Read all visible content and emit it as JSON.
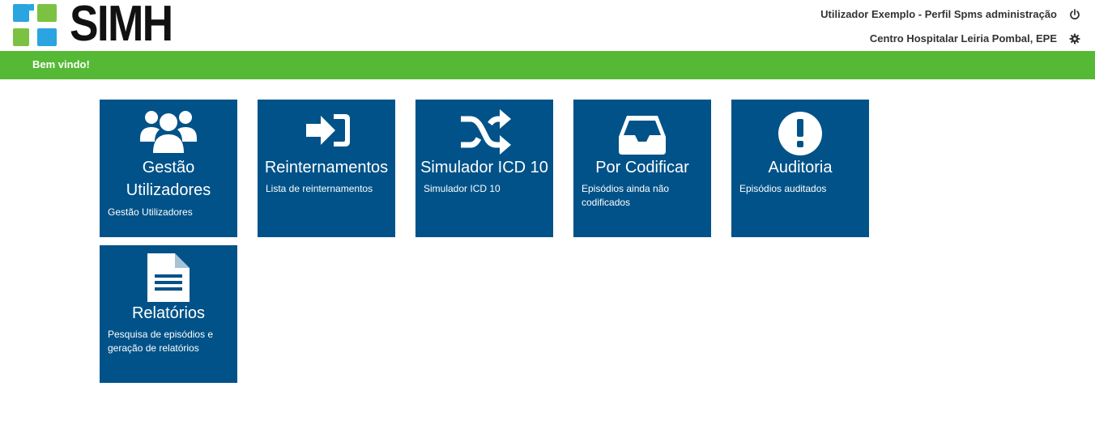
{
  "app": {
    "logo_text": "SIMH",
    "user_line": "Utilizador Exemplo - Perfil Spms administração",
    "org_line": "Centro Hospitalar Leiria Pombal, EPE",
    "welcome": "Bem vindo!"
  },
  "colors": {
    "tile_bg": "#005288",
    "welcome_bar": "#56b935",
    "logo_blue": "#2aa5e0",
    "logo_green": "#7cc242"
  },
  "icons": {
    "power": "power-icon",
    "settings": "gear-icon"
  },
  "tiles": [
    {
      "title": "Gestão Utilizadores",
      "title_line1": "Gestão",
      "title_line2": "Utilizadores",
      "desc": "Gestão Utilizadores",
      "icon": "users-icon"
    },
    {
      "title": "Reinternamentos",
      "desc": "Lista de reinternamentos",
      "icon": "sign-in-icon"
    },
    {
      "title": "Simulador ICD 10",
      "desc": "Simulador ICD 10",
      "icon": "shuffle-icon"
    },
    {
      "title": "Por Codificar",
      "desc_line1": "Episódios ainda não",
      "desc_line2": "codificados",
      "icon": "inbox-icon"
    },
    {
      "title": "Auditoria",
      "desc": "Episódios auditados",
      "icon": "exclamation-circle-icon"
    },
    {
      "title": "Relatórios",
      "desc_line1": "Pesquisa de episódios e",
      "desc_line2": "geração de relatórios",
      "icon": "file-text-icon"
    }
  ]
}
